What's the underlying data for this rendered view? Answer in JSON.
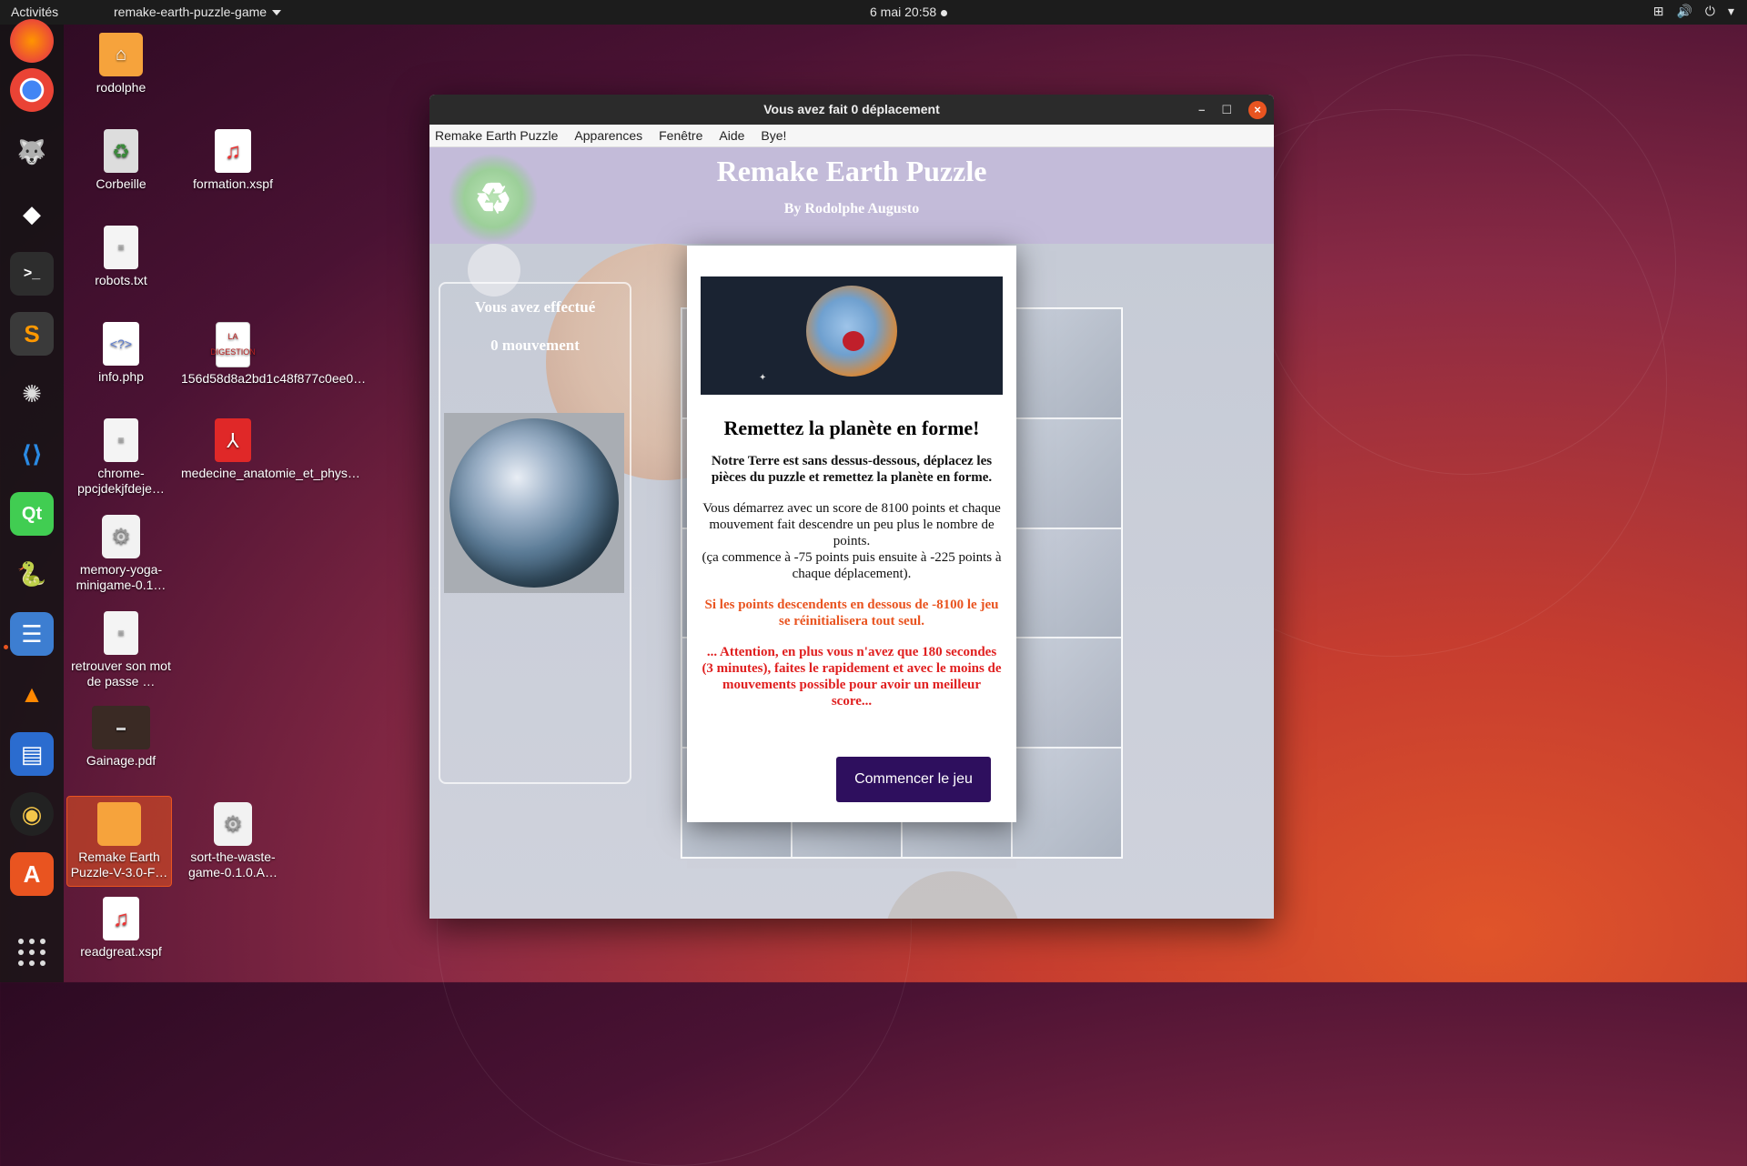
{
  "topbar": {
    "activities": "Activités",
    "app_menu": "remake-earth-puzzle-game",
    "clock": "6 mai  20:58"
  },
  "desktop": {
    "icons": [
      {
        "label": "rodolphe",
        "icon": "home-folder-icon"
      },
      {
        "label": "Corbeille",
        "icon": "trash-icon"
      },
      {
        "label": "formation.xspf",
        "icon": "music-file-icon"
      },
      {
        "label": "robots.txt",
        "icon": "text-file-icon"
      },
      {
        "label": "info.php",
        "icon": "php-file-icon"
      },
      {
        "label": "156d58d8a2bd1c48f877c0ee0…",
        "icon": "book-cover-icon"
      },
      {
        "label": "chrome-ppcjdekjfdeje…",
        "icon": "text-file-icon"
      },
      {
        "label": "medecine_anatomie_et_phys…",
        "icon": "pdf-file-icon"
      },
      {
        "label": "memory-yoga-minigame-0.1…",
        "icon": "package-icon"
      },
      {
        "label": "retrouver son mot de passe …",
        "icon": "text-file-icon"
      },
      {
        "label": "Gainage.pdf",
        "icon": "pdf-thumbnail-icon"
      },
      {
        "label": "Remake Earth Puzzle-V-3.0-F…",
        "icon": "folder-icon"
      },
      {
        "label": "sort-the-waste-game-0.1.0.A…",
        "icon": "package-icon"
      },
      {
        "label": "readgreat.xspf",
        "icon": "music-file-icon"
      }
    ]
  },
  "window": {
    "title": "Vous avez fait 0 déplacement",
    "menu": [
      "Remake Earth Puzzle",
      "Apparences",
      "Fenêtre",
      "Aide",
      "Bye!"
    ]
  },
  "game": {
    "title": "Remake Earth Puzzle",
    "subtitle": "By Rodolphe Augusto",
    "moves_line1": "Vous avez effectué",
    "moves_line2": "0 mouvement"
  },
  "modal": {
    "heading": "Remettez la planète en forme!",
    "p1": "Notre Terre est sans dessus-dessous, déplacez les pièces du puzzle et remettez la planète en forme.",
    "p2a": "Vous démarrez avec un score de 8100 points et chaque mouvement fait descendre un peu plus le nombre de points.",
    "p2b": "(ça commence à -75 points puis ensuite à -225 points à chaque déplacement).",
    "p3": "Si les points descendents en dessous de -8100 le jeu se réinitialisera tout seul.",
    "p4": "... Attention, en plus vous n'avez que 180 secondes (3 minutes), faites le rapidement et avec le moins de mouvements possible pour avoir un meilleur score...",
    "start_button": "Commencer le jeu"
  },
  "colors": {
    "accent": "#e95420",
    "button": "#2e0f5e",
    "warning_red": "#e02020"
  }
}
